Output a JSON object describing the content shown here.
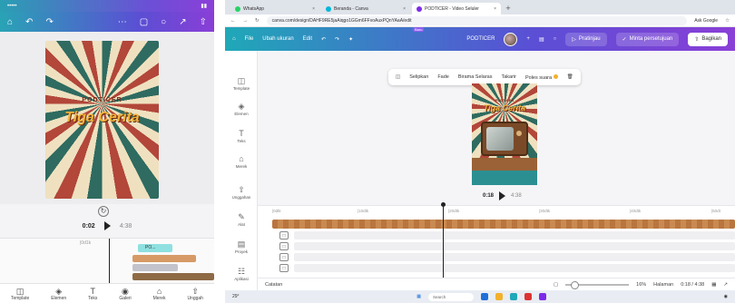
{
  "phone": {
    "status_left": "•••••",
    "status_right": "▮▮",
    "poster_subtitle": "PODTICER",
    "poster_title": "Tiga Cerita",
    "current_time": "0:02",
    "total_time": "4:38",
    "ruler_label": "|0d1k",
    "clip_label": "PO...",
    "nav": [
      "Template",
      "Elemen",
      "Teks",
      "Galeri",
      "Merek",
      "Unggah"
    ]
  },
  "browser": {
    "tabs": [
      {
        "label": "WhatsApp",
        "color": "#25d366"
      },
      {
        "label": "Beranda - Canva",
        "color": "#00b8d9"
      },
      {
        "label": "PODTICER - Video Seluler",
        "color": "#7d2ae8"
      }
    ],
    "url": "canva.com/design/DAHF9RE5jaAiqgo1GGm6FFvoAuxPQnYAaA/edit",
    "ask_google": "Ask Google"
  },
  "canva": {
    "file": "File",
    "resize": "Ubah ukuran",
    "edit": "Edit",
    "new_badge": "Baru",
    "doc_title": "PODTICER",
    "preview": "Pratinjau",
    "approval": "Minta persetujuan",
    "share": "Bagikan",
    "rail": [
      "Template",
      "Elemen",
      "Teks",
      "Merek",
      "Unggahan",
      "Alat",
      "Proyek",
      "Aplikasi"
    ],
    "ctx": [
      "Selipkan",
      "Fade",
      "Birama Selaras",
      "Takarir",
      "Poles suara"
    ],
    "poster_subtitle": "PODTICER",
    "poster_title": "Tiga Cerita",
    "current_time": "0:18",
    "total_time": "4:38",
    "ruler": [
      "|0dtk",
      "|10dtk",
      "|20dtk",
      "|30dtk",
      "|40dtk",
      "|50dt"
    ],
    "notes": "Catatan",
    "zoom": "16%",
    "pages": "Halaman",
    "time_readout": "0:18 / 4:38"
  },
  "taskbar": {
    "weather": "29°",
    "search": "Search"
  }
}
